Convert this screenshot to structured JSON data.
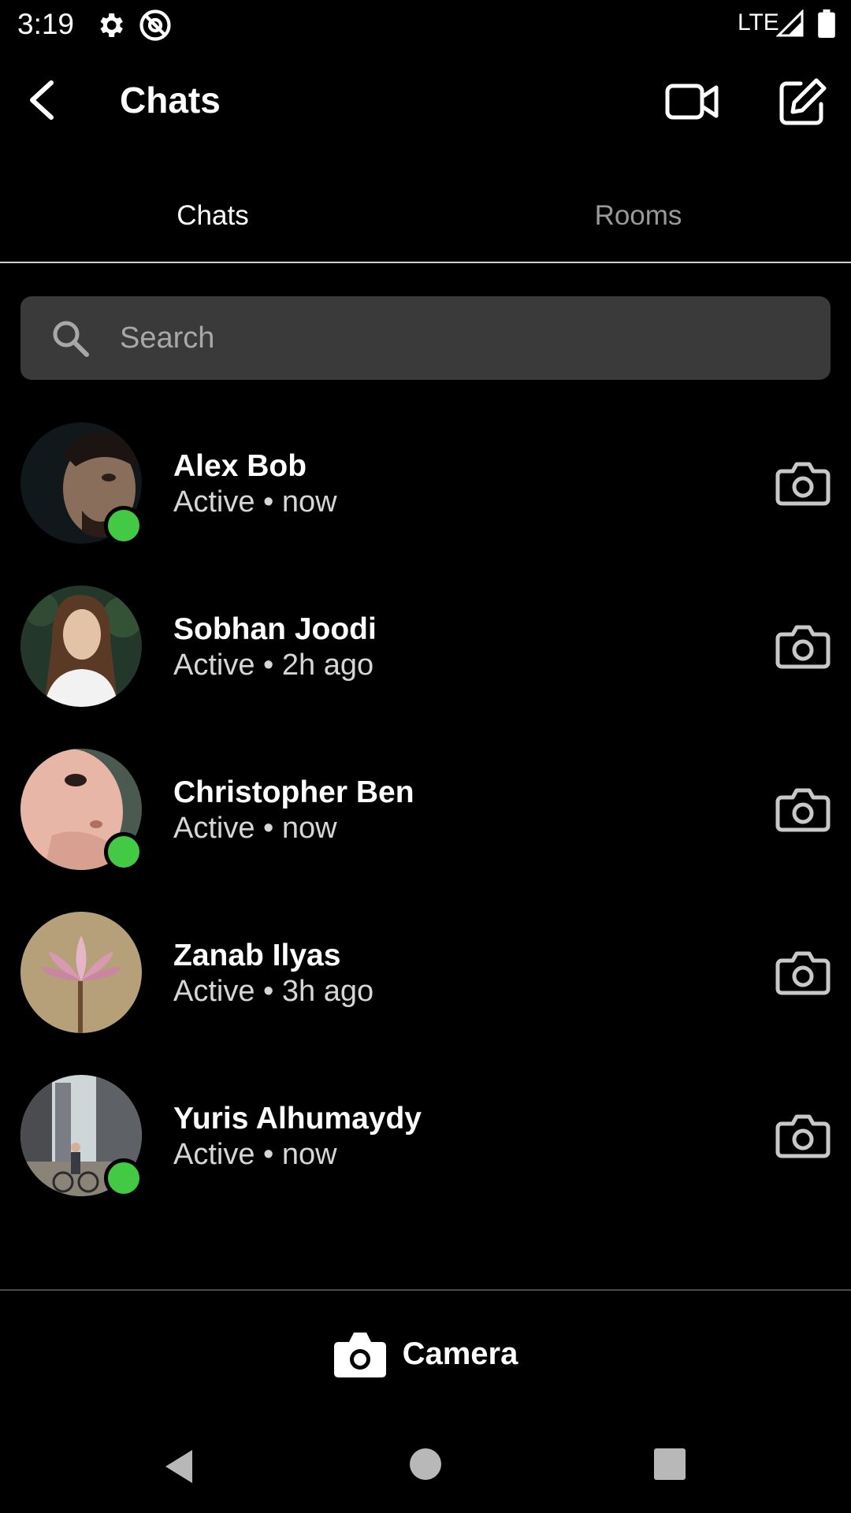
{
  "status_bar": {
    "time": "3:19",
    "network": "LTE",
    "icons": [
      "gear-icon",
      "at-sign-icon",
      "signal-icon",
      "battery-icon"
    ]
  },
  "header": {
    "title": "Chats",
    "icons": [
      "back-arrow-icon",
      "video-camera-icon",
      "compose-icon"
    ]
  },
  "tabs": [
    {
      "label": "Chats",
      "active": true
    },
    {
      "label": "Rooms",
      "active": false
    }
  ],
  "search": {
    "placeholder": "Search",
    "value": ""
  },
  "chats": [
    {
      "name": "Alex Bob",
      "status": "Active • now",
      "online": true,
      "avatar": "man-portrait"
    },
    {
      "name": "Sobhan Joodi",
      "status": "Active • 2h ago",
      "online": false,
      "avatar": "woman-portrait"
    },
    {
      "name": "Christopher Ben",
      "status": "Active • now",
      "online": true,
      "avatar": "baby-face"
    },
    {
      "name": "Zanab Ilyas",
      "status": "Active • 3h ago",
      "online": false,
      "avatar": "lotus-flower"
    },
    {
      "name": "Yuris Alhumaydy",
      "status": "Active • now",
      "online": true,
      "avatar": "city-street-cyclist"
    }
  ],
  "bottom_bar": {
    "camera_label": "Camera"
  },
  "colors": {
    "background": "#000000",
    "search_bg": "#3a3a3a",
    "online": "#44c944",
    "inactive_tab": "#9a9a9a"
  }
}
